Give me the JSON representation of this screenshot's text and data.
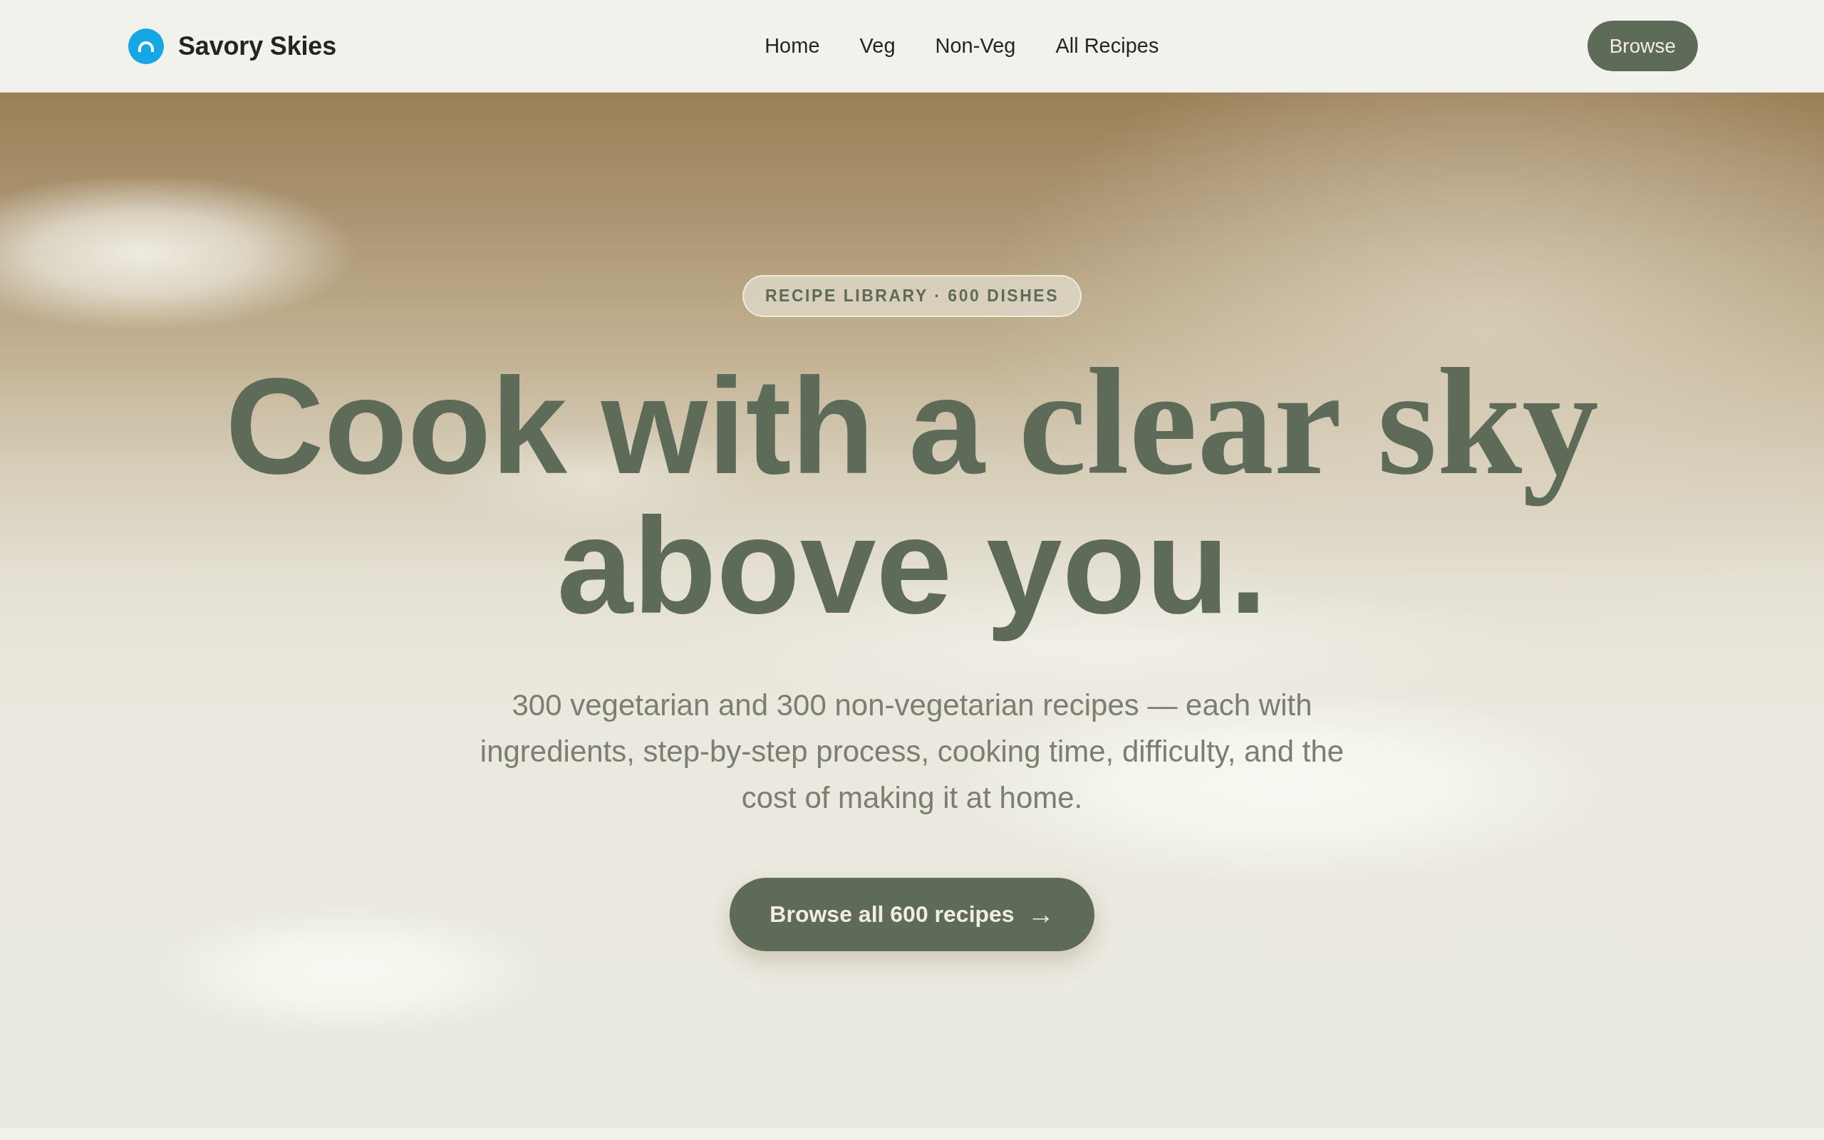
{
  "nav": {
    "brand": "Savory Skies",
    "links": [
      "Home",
      "Veg",
      "Non-Veg",
      "All Recipes"
    ],
    "action": "Browse"
  },
  "hero": {
    "badge": "RECIPE LIBRARY · 600 DISHES",
    "headline": {
      "lead": "Cook with a",
      "accent": "clear sky",
      "tail": "above you."
    },
    "subtitle": "300 vegetarian and 300 non-vegetarian recipes — each with ingredients, step-by-step process, cooking time, difficulty, and the cost of making it at home.",
    "cta": {
      "label": "Browse all 600 recipes",
      "arrow": "→"
    }
  }
}
